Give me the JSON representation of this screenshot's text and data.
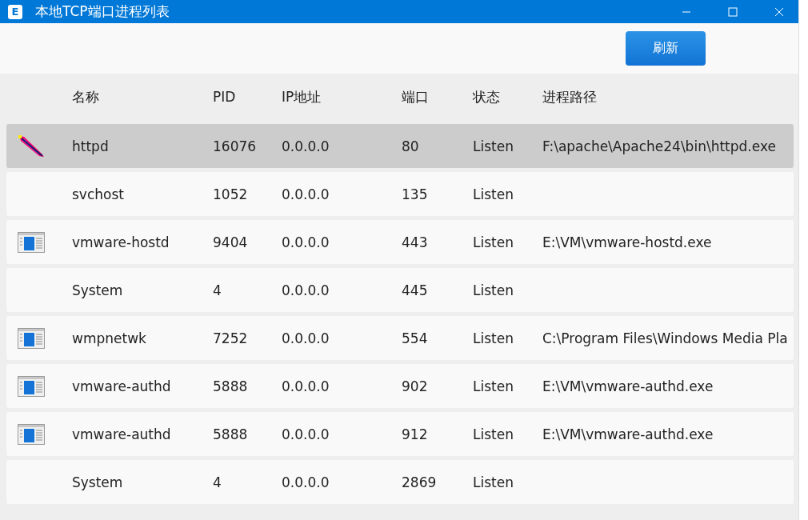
{
  "window": {
    "title": "本地TCP端口进程列表",
    "app_icon": "E"
  },
  "toolbar": {
    "refresh_button": "刷新"
  },
  "table": {
    "columns": [
      "名称",
      "PID",
      "IP地址",
      "端口",
      "状态",
      "进程路径"
    ],
    "rows": [
      {
        "kind": "feather",
        "selected": true,
        "cells": [
          "httpd",
          "16076",
          "0.0.0.0",
          "80",
          "Listen",
          "F:\\apache\\Apache24\\bin\\httpd.exe"
        ]
      },
      {
        "kind": "plain",
        "selected": false,
        "cells": [
          "svchost",
          "1052",
          "0.0.0.0",
          "135",
          "Listen"
        ]
      },
      {
        "kind": "window",
        "selected": false,
        "cells": [
          "vmware-hostd",
          "9404",
          "0.0.0.0",
          "443",
          "Listen",
          "E:\\VM\\vmware-hostd.exe"
        ]
      },
      {
        "kind": "plain",
        "selected": false,
        "cells": [
          "System",
          "4",
          "0.0.0.0",
          "445",
          "Listen"
        ]
      },
      {
        "kind": "window",
        "selected": false,
        "cells": [
          "wmpnetwk",
          "7252",
          "0.0.0.0",
          "554",
          "Listen",
          "C:\\Program Files\\Windows Media Pla"
        ]
      },
      {
        "kind": "window",
        "selected": false,
        "cells": [
          "vmware-authd",
          "5888",
          "0.0.0.0",
          "902",
          "Listen",
          "E:\\VM\\vmware-authd.exe"
        ]
      },
      {
        "kind": "window",
        "selected": false,
        "cells": [
          "vmware-authd",
          "5888",
          "0.0.0.0",
          "912",
          "Listen",
          "E:\\VM\\vmware-authd.exe"
        ]
      },
      {
        "kind": "plain",
        "selected": false,
        "cells": [
          "System",
          "4",
          "0.0.0.0",
          "2869",
          "Listen"
        ]
      }
    ]
  }
}
